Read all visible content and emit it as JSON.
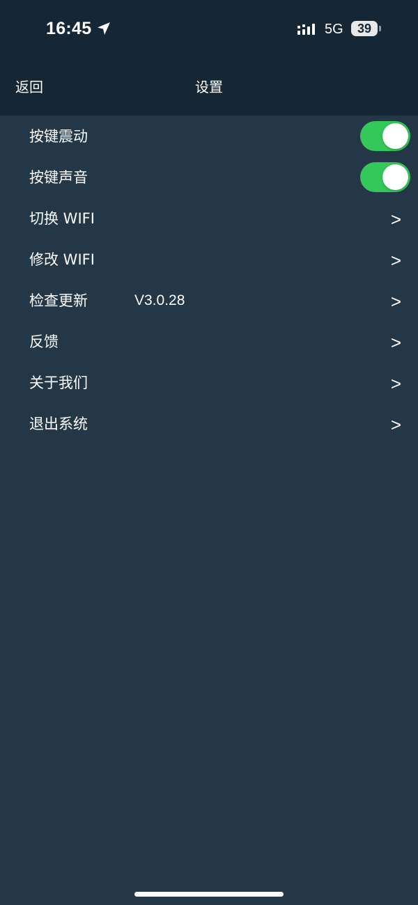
{
  "status_bar": {
    "time": "16:45",
    "network": "5G",
    "battery": "39",
    "location_icon": "location-arrow-icon",
    "signal_icon": "cellular-signal-icon"
  },
  "nav": {
    "back_label": "返回",
    "title": "设置"
  },
  "settings": {
    "vibration": {
      "label": "按键震动",
      "on": true
    },
    "sound": {
      "label": "按键声音",
      "on": true
    },
    "switch_wifi": {
      "label": "切换 WIFI",
      "arrow": ">"
    },
    "modify_wifi": {
      "label": "修改 WIFI",
      "arrow": ">"
    },
    "check_update": {
      "label": "检查更新",
      "version": "V3.0.28",
      "arrow": ">"
    },
    "feedback": {
      "label": "反馈",
      "arrow": ">"
    },
    "about_us": {
      "label": "关于我们",
      "arrow": ">"
    },
    "logout": {
      "label": "退出系统",
      "arrow": ">"
    }
  },
  "colors": {
    "header_bg": "#152634",
    "page_bg": "#243747",
    "toggle_on": "#34c759"
  }
}
